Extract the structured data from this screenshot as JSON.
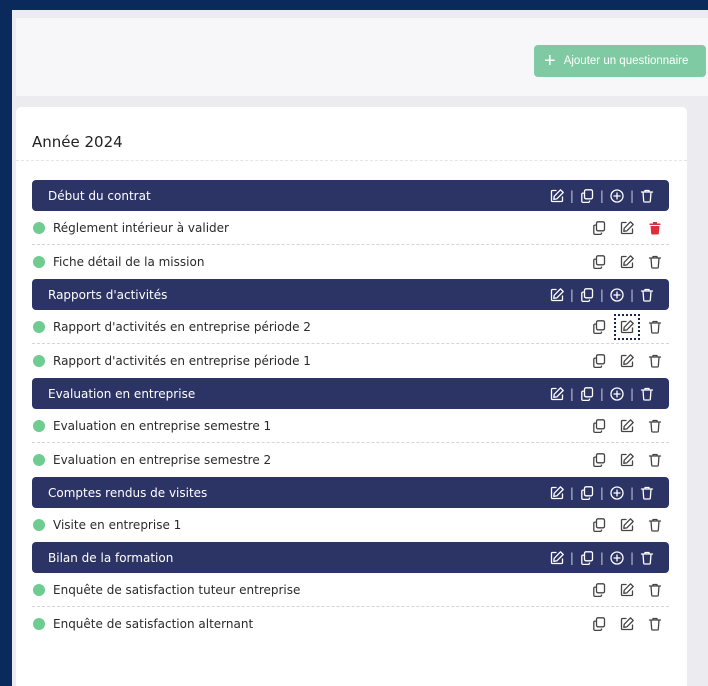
{
  "toolbar": {
    "add_label": "Ajouter un questionnaire",
    "add_color": "#7fcaa2"
  },
  "card": {
    "year_title": "Année 2024"
  },
  "colors": {
    "header_bg": "#2c3466",
    "status_dot": "#6fcc91",
    "delete_active": "#d9303c"
  },
  "sections": [
    {
      "title": "Début du contrat",
      "items": [
        {
          "label": "Réglement intérieur à valider",
          "delete_active": true
        },
        {
          "label": "Fiche détail de la mission"
        }
      ]
    },
    {
      "title": "Rapports d'activités",
      "items": [
        {
          "label": "Rapport d'activités en entreprise période 2",
          "edit_focused": true
        },
        {
          "label": "Rapport d'activités en entreprise période 1"
        }
      ]
    },
    {
      "title": "Evaluation en entreprise",
      "items": [
        {
          "label": "Evaluation en entreprise semestre 1"
        },
        {
          "label": "Evaluation en entreprise semestre 2"
        }
      ]
    },
    {
      "title": "Comptes rendus de visites",
      "items": [
        {
          "label": "Visite en entreprise 1"
        }
      ]
    },
    {
      "title": "Bilan de la formation",
      "items": [
        {
          "label": "Enquête de satisfaction tuteur entreprise"
        },
        {
          "label": "Enquête de satisfaction alternant"
        }
      ]
    }
  ],
  "icons": {
    "edit": "edit-icon",
    "copy": "copy-icon",
    "add": "plus-circle-icon",
    "delete": "trash-icon"
  }
}
